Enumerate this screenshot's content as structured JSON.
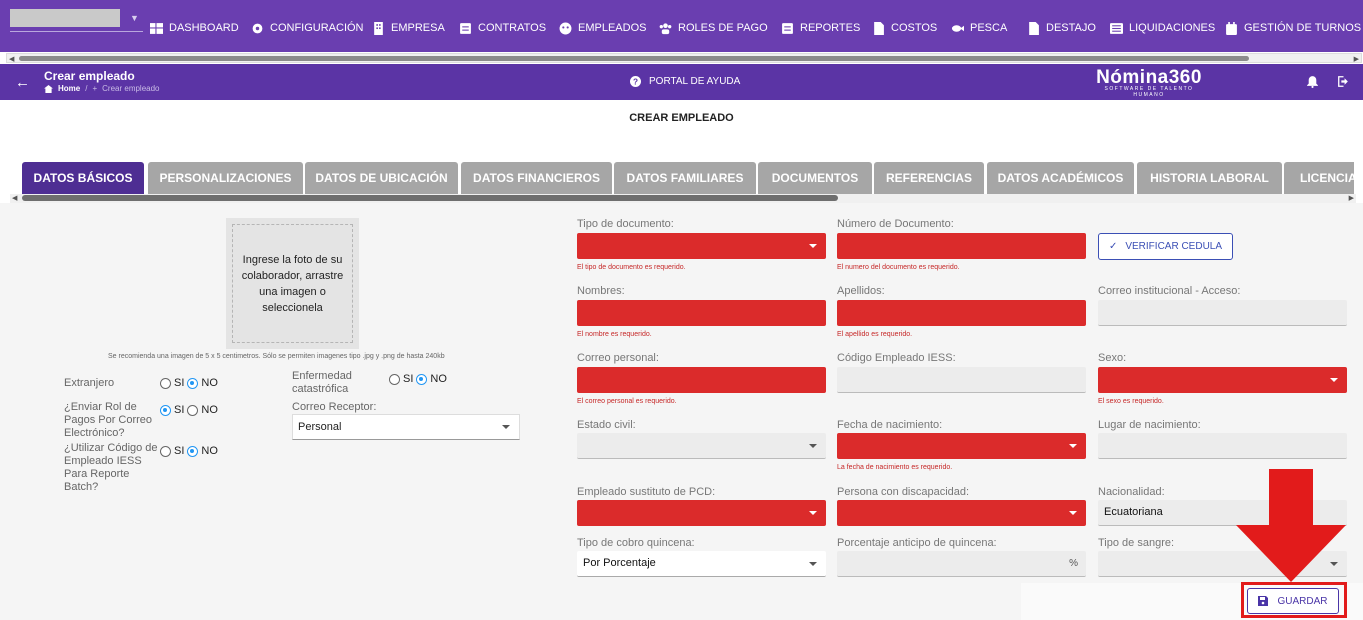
{
  "topnav": {
    "items": [
      {
        "label": "DASHBOARD",
        "icon": "dashboard-icon"
      },
      {
        "label": "CONFIGURACIÓN",
        "icon": "gear-icon"
      },
      {
        "label": "EMPRESA",
        "icon": "building-icon"
      },
      {
        "label": "CONTRATOS",
        "icon": "contract-icon"
      },
      {
        "label": "EMPLEADOS",
        "icon": "employees-icon"
      },
      {
        "label": "ROLES DE PAGO",
        "icon": "users-icon"
      },
      {
        "label": "REPORTES",
        "icon": "report-icon"
      },
      {
        "label": "COSTOS",
        "icon": "file-icon"
      },
      {
        "label": "PESCA",
        "icon": "fish-icon"
      },
      {
        "label": "DESTAJO",
        "icon": "document-icon"
      },
      {
        "label": "LIQUIDACIONES",
        "icon": "list-icon"
      },
      {
        "label": "GESTIÓN DE TURNOS",
        "icon": "calendar-icon"
      }
    ]
  },
  "header": {
    "title": "Crear empleado",
    "breadcrumb_home": "Home",
    "breadcrumb_sep": "/",
    "breadcrumb_current": "Crear empleado",
    "help": "PORTAL DE AYUDA",
    "logo_name": "Nómina360",
    "logo_tagline": "SOFTWARE DE TALENTO HUMANO"
  },
  "form": {
    "title": "CREAR EMPLEADO",
    "tabs": [
      "DATOS BÁSICOS",
      "PERSONALIZACIONES",
      "DATOS DE UBICACIÓN",
      "DATOS FINANCIEROS",
      "DATOS FAMILIARES",
      "DOCUMENTOS",
      "REFERENCIAS",
      "DATOS ACADÉMICOS",
      "HISTORIA LABORAL",
      "LICENCIAS"
    ],
    "active_tab": "DATOS BÁSICOS"
  },
  "photo": {
    "prompt": "Ingrese la foto de su colaborador, arrastre una imagen o seleccionela",
    "note": "Se recomienda una imagen de 5 x 5 centimetros. Sólo se permiten imagenes tipo .jpg y .png de hasta 240kb"
  },
  "left": {
    "extranjero": "Extranjero",
    "enviar_rol": "¿Enviar Rol de Pagos Por Correo Electrónico?",
    "utilizar_codigo": "¿Utilizar Código de Empleado IESS Para Reporte Batch?",
    "enfermedad": "Enfermedad catastrófica",
    "correo_receptor_label": "Correo Receptor:",
    "correo_receptor_value": "Personal",
    "si": "SI",
    "no": "NO"
  },
  "fields": {
    "tipo_documento": {
      "label": "Tipo de documento:",
      "error": "El tipo de documento es requerido."
    },
    "numero_documento": {
      "label": "Número de Documento:",
      "error": "El numero del documento es requerido."
    },
    "verificar": "VERIFICAR CEDULA",
    "nombres": {
      "label": "Nombres:",
      "error": "El nombre es requerido."
    },
    "apellidos": {
      "label": "Apellidos:",
      "error": "El apellido es requerido."
    },
    "correo_institucional": {
      "label": "Correo institucional - Acceso:"
    },
    "correo_personal": {
      "label": "Correo personal:",
      "error": "El correo personal es requerido."
    },
    "codigo_iess": {
      "label": "Código Empleado IESS:"
    },
    "sexo": {
      "label": "Sexo:",
      "error": "El sexo es requerido."
    },
    "estado_civil": {
      "label": "Estado civil:"
    },
    "fecha_nacimiento": {
      "label": "Fecha de nacimiento:",
      "error": "La fecha de nacimiento es requerido."
    },
    "lugar_nacimiento": {
      "label": "Lugar de nacimiento:"
    },
    "sustituto_pcd": {
      "label": "Empleado sustituto de PCD:"
    },
    "discapacidad": {
      "label": "Persona con discapacidad:"
    },
    "nacionalidad": {
      "label": "Nacionalidad:",
      "value": "Ecuatoriana"
    },
    "tipo_cobro": {
      "label": "Tipo de cobro quincena:",
      "value": "Por Porcentaje"
    },
    "porcentaje_anticipo": {
      "label": "Porcentaje anticipo de quincena:",
      "suffix": "%"
    },
    "tipo_sangre": {
      "label": "Tipo de sangre:"
    }
  },
  "actions": {
    "guardar": "GUARDAR"
  },
  "colors": {
    "primary": "#6a3eb0",
    "required": "#db2b2b",
    "annotation": "#e21b1b"
  }
}
